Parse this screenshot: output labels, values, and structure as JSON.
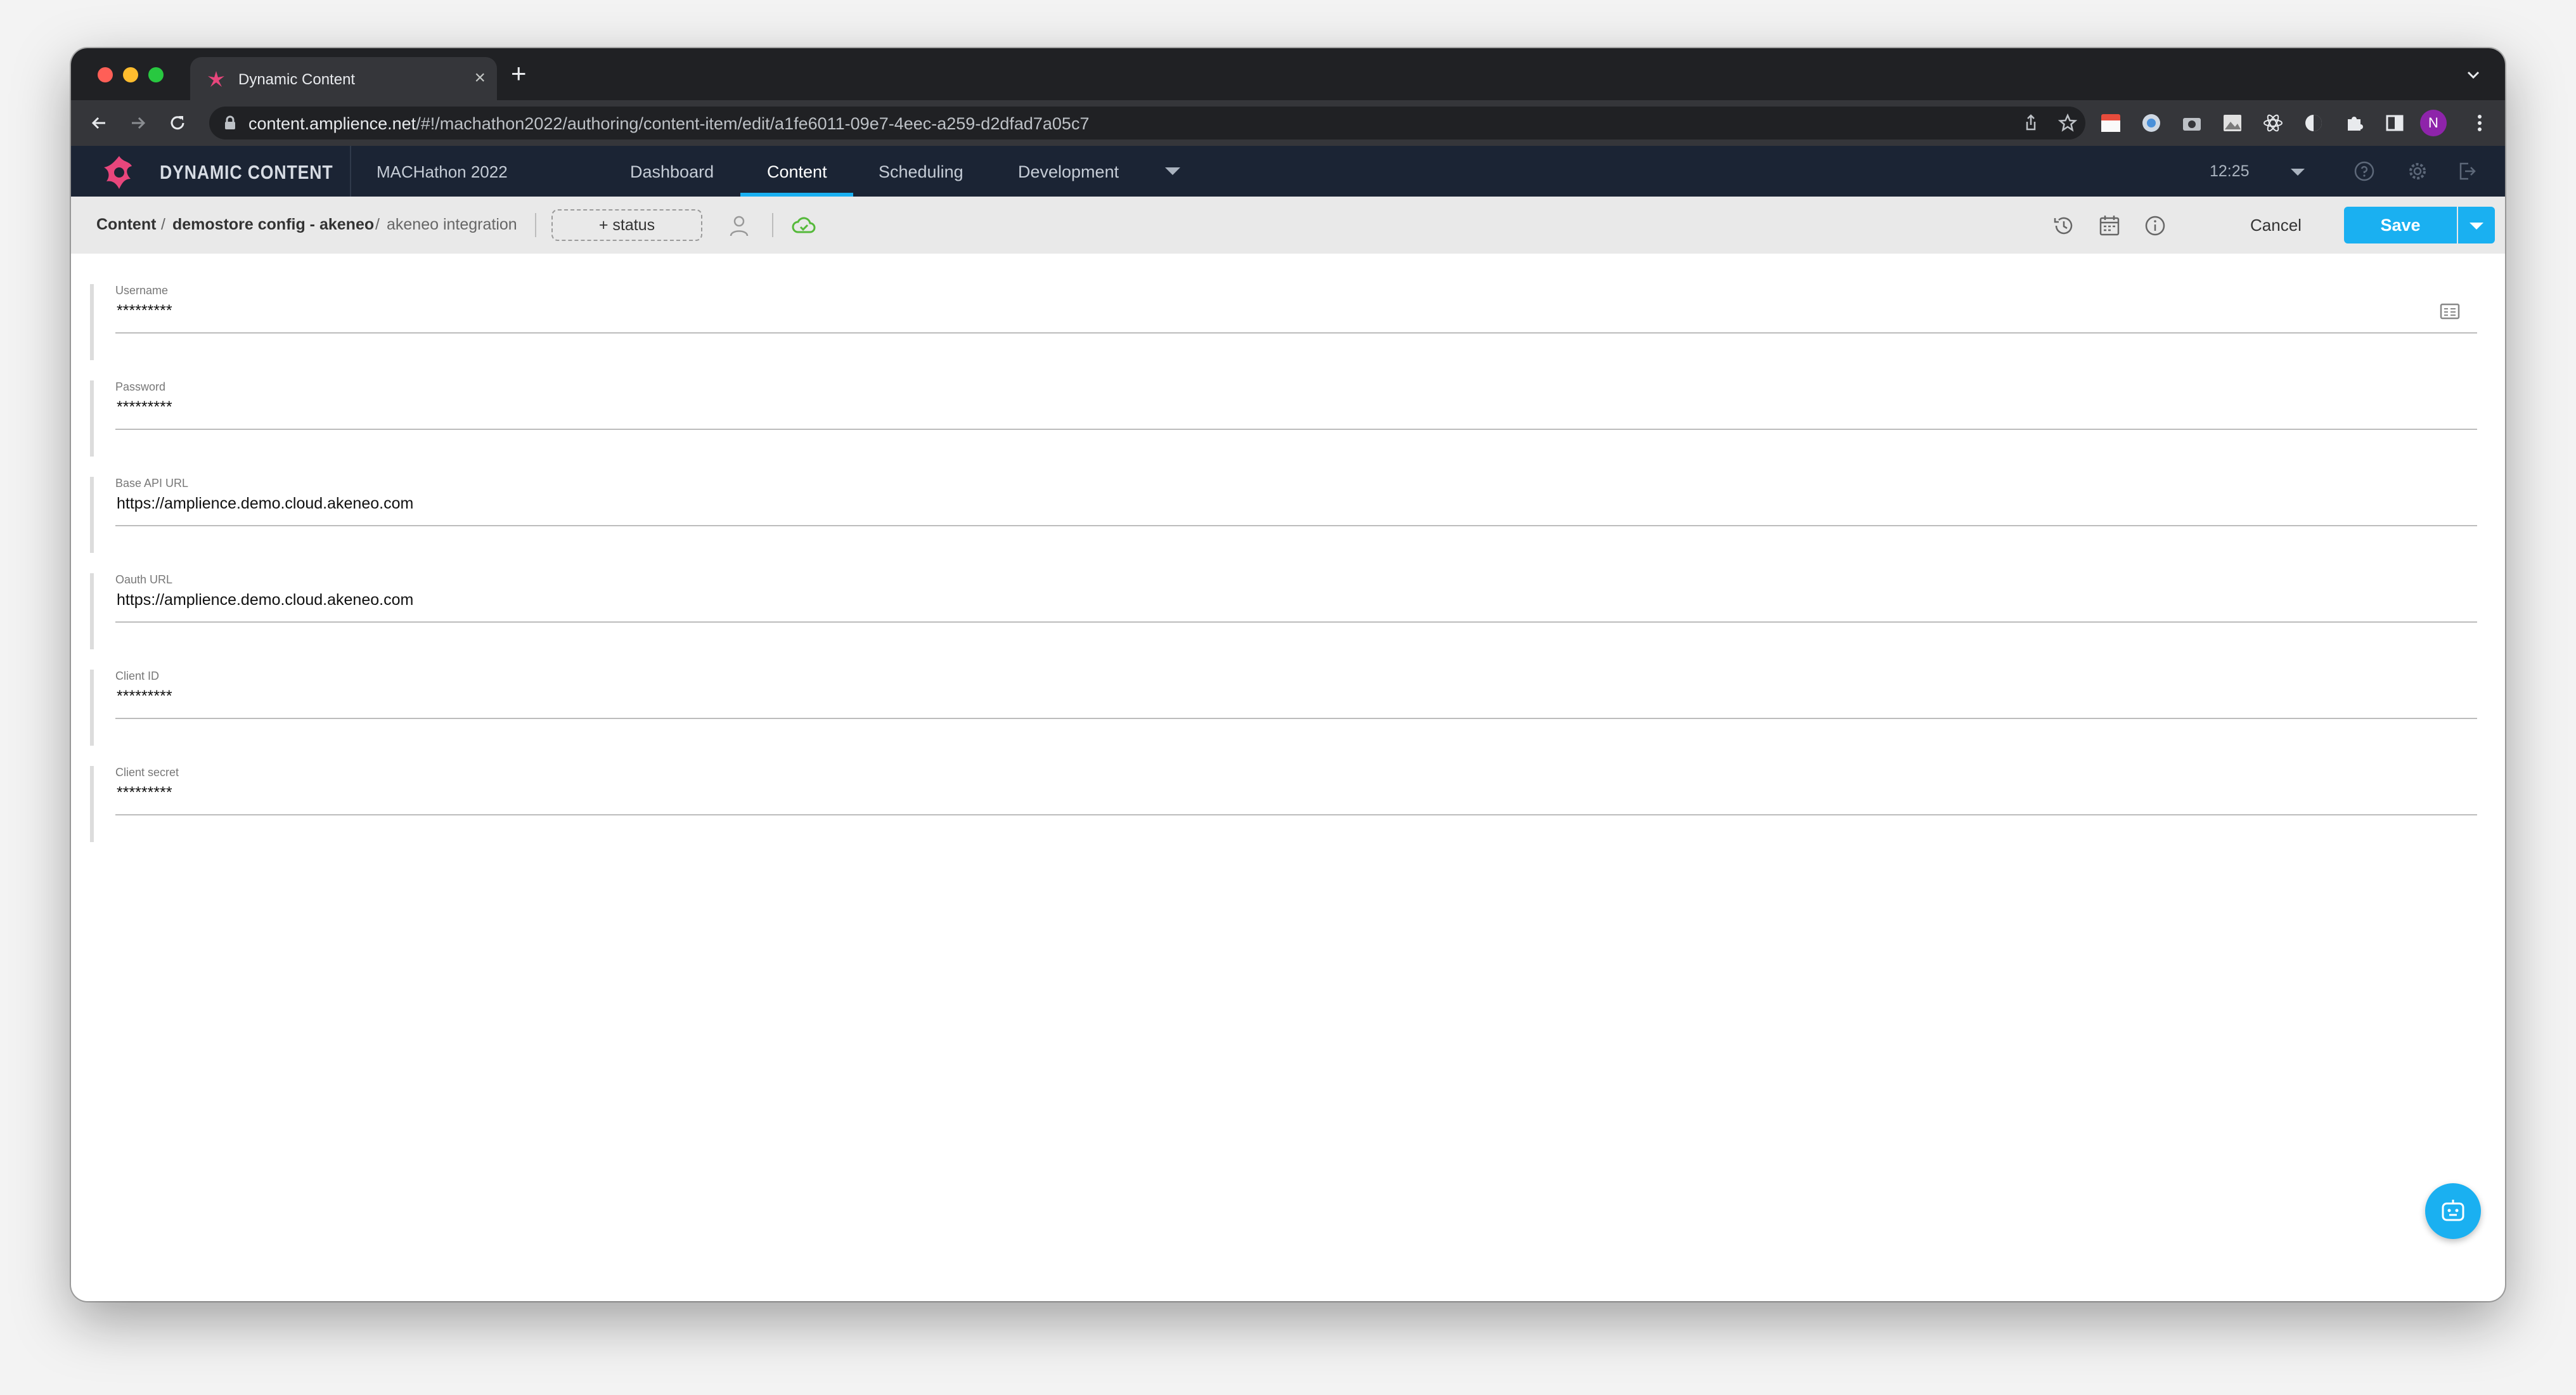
{
  "browser": {
    "tab_title": "Dynamic Content",
    "url_host": "content.amplience.net",
    "url_path": "/#!/machathon2022/authoring/content-item/edit/a1fe6011-09e7-4eec-a259-d2dfad7a05c7",
    "profile_initial": "N"
  },
  "app": {
    "brand": "DYNAMIC CONTENT",
    "hub": "MACHathon 2022",
    "nav": [
      {
        "label": "Dashboard"
      },
      {
        "label": "Content"
      },
      {
        "label": "Scheduling"
      },
      {
        "label": "Development"
      }
    ],
    "active_nav": "Content",
    "time": "12:25",
    "accent_color": "#1ab0f1",
    "header_color": "#1b2434"
  },
  "breadcrumb": {
    "root": "Content",
    "folder": "demostore config - akeneo",
    "item": "akeneo integration",
    "status_button": "+ status"
  },
  "actions": {
    "cancel": "Cancel",
    "save": "Save"
  },
  "form": {
    "fields": [
      {
        "label": "Username",
        "value": "*********"
      },
      {
        "label": "Password",
        "value": "*********"
      },
      {
        "label": "Base API URL",
        "value": "https://amplience.demo.cloud.akeneo.com"
      },
      {
        "label": "Oauth URL",
        "value": "https://amplience.demo.cloud.akeneo.com"
      },
      {
        "label": "Client ID",
        "value": "*********"
      },
      {
        "label": "Client secret",
        "value": "*********"
      }
    ]
  },
  "icons": {
    "tabstrip": [
      "amplience-favicon-icon",
      "close-icon",
      "plus-icon",
      "chevron-down-icon"
    ],
    "toolbar": [
      "back-arrow-icon",
      "forward-arrow-icon",
      "reload-icon",
      "lock-icon",
      "share-icon",
      "star-icon"
    ],
    "header": [
      "help-icon",
      "gear-icon",
      "logout-icon"
    ],
    "crumbbar": [
      "user-icon",
      "cloud-sync-icon",
      "history-icon",
      "calendar-icon",
      "info-icon"
    ]
  }
}
